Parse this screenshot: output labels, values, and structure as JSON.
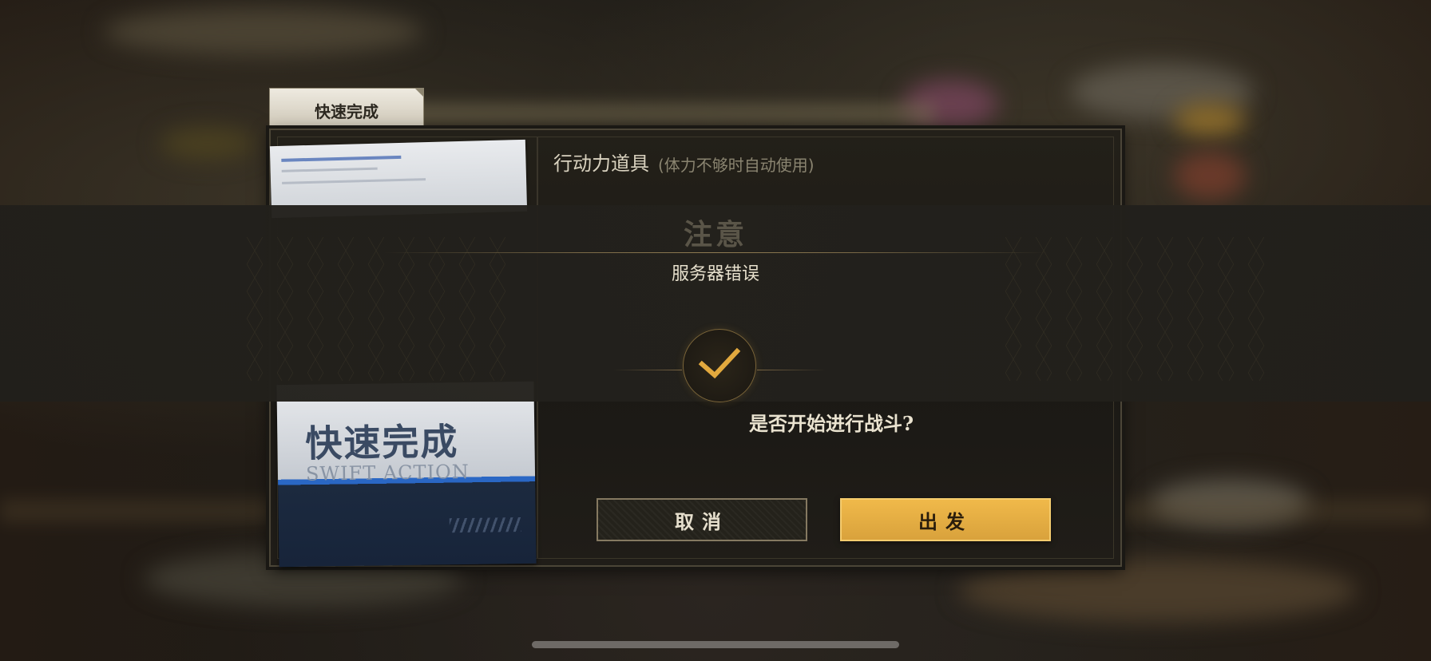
{
  "tab": {
    "label": "快速完成"
  },
  "item": {
    "title": "行动力道具",
    "subtitle": "(体力不够时自动使用)"
  },
  "illustration": {
    "title_cn": "快速完成",
    "title_en": "SWIFT ACTION"
  },
  "notice": {
    "title": "注意",
    "message": "服务器错误",
    "confirm_icon": "checkmark-icon"
  },
  "dialog": {
    "prompt": "是否开始进行战斗?",
    "cancel_label": "取消",
    "go_label": "出发"
  },
  "colors": {
    "accent_gold": "#e8b04a",
    "panel_bg": "#1f1c17",
    "banner_bg": "#23211c"
  }
}
